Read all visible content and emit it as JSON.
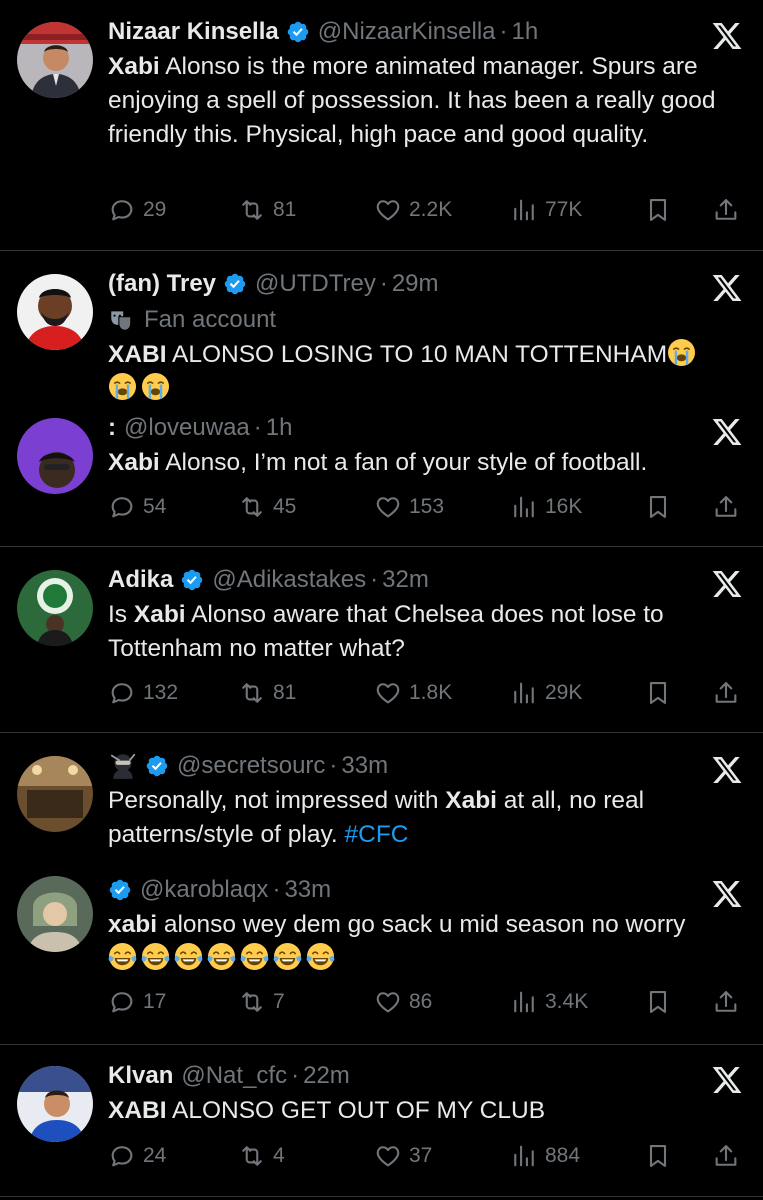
{
  "colors": {
    "background": "#000000",
    "text": "#e7e9ea",
    "muted": "#71767b",
    "verified": "#1d9bf0",
    "hashtag": "#1d9bf0",
    "divider": "#2f3336"
  },
  "tweets": [
    {
      "name": "Nizaar Kinsella",
      "verified": true,
      "handle": "@NizaarKinsella",
      "time": "1h",
      "text_parts": [
        {
          "b": "Xabi"
        },
        {
          "t": " Alonso is the more animated manager. Spurs are enjoying a spell of possession. It has been a really good friendly this. Physical, high pace and good quality."
        }
      ],
      "stats": {
        "replies": "29",
        "reposts": "81",
        "likes": "2.2K",
        "views": "77K"
      }
    },
    {
      "name": "(fan) Trey",
      "verified": true,
      "handle": "@UTDTrey",
      "time": "29m",
      "label": "Fan account",
      "label_icon": "theater-masks-icon",
      "text_parts": [
        {
          "b": "XABI"
        },
        {
          "t": " ALONSO LOSING TO 10 MAN TOTTENHAM"
        }
      ],
      "emojis": [
        "loudly-crying-face",
        "loudly-crying-face",
        "loudly-crying-face"
      ],
      "quoted": {
        "name": ":",
        "handle": "@loveuwaa",
        "time": "1h",
        "text_parts": [
          {
            "b": "Xabi"
          },
          {
            "t": " Alonso, I’m not a fan of your style of football."
          }
        ]
      },
      "stats": {
        "replies": "54",
        "reposts": "45",
        "likes": "153",
        "views": "16K"
      }
    },
    {
      "name": "Adika",
      "verified": true,
      "handle": "@Adikastakes",
      "time": "32m",
      "text_parts": [
        {
          "t": "Is "
        },
        {
          "b": "Xabi"
        },
        {
          "t": " Alonso aware that Chelsea does not lose to Tottenham no matter what?"
        }
      ],
      "stats": {
        "replies": "132",
        "reposts": "81",
        "likes": "1.8K",
        "views": "29K"
      }
    },
    {
      "name_icon": "ninja-icon",
      "verified": true,
      "handle": "@secretsourc",
      "time": "33m",
      "text_parts": [
        {
          "t": "Personally, not impressed with "
        },
        {
          "b": "Xabi"
        },
        {
          "t": " at all, no real patterns/style of play. "
        },
        {
          "h": "#CFC"
        }
      ],
      "reply": {
        "verified": true,
        "handle": "@karoblaqx",
        "time": "33m",
        "text_parts": [
          {
            "b": "xabi"
          },
          {
            "t": " alonso wey dem go sack u mid season no worry"
          }
        ],
        "emojis": [
          "laughing-crying-face",
          "laughing-crying-face",
          "laughing-crying-face",
          "laughing-crying-face",
          "laughing-crying-face",
          "laughing-crying-face",
          "laughing-crying-face"
        ]
      },
      "stats": {
        "replies": "17",
        "reposts": "7",
        "likes": "86",
        "views": "3.4K"
      }
    },
    {
      "name": "Klvan",
      "verified": false,
      "handle": "@Nat_cfc",
      "time": "22m",
      "text_parts": [
        {
          "b": "XABI"
        },
        {
          "t": " ALONSO GET OUT OF MY CLUB"
        }
      ],
      "stats": {
        "replies": "24",
        "reposts": "4",
        "likes": "37",
        "views": "884"
      }
    }
  ]
}
